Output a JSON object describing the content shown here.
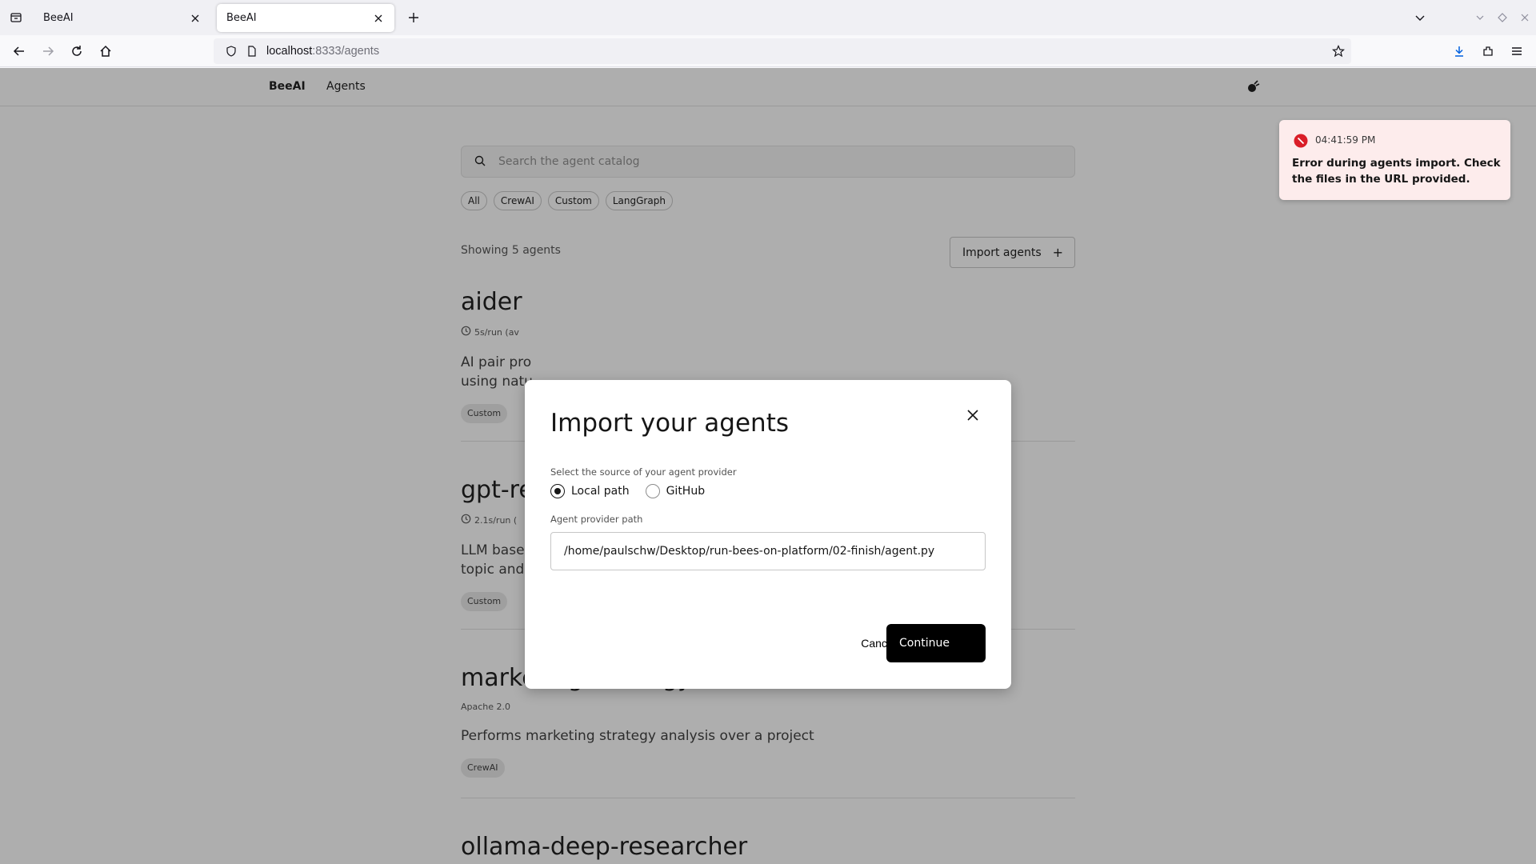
{
  "browser": {
    "tabs": [
      {
        "title": "BeeAI"
      },
      {
        "title": "BeeAI"
      }
    ],
    "url_host": "localhost",
    "url_path": ":8333/agents"
  },
  "app": {
    "brand": "BeeAI",
    "nav_agents": "Agents",
    "search_placeholder": "Search the agent catalog",
    "filters": [
      "All",
      "CrewAI",
      "Custom",
      "LangGraph"
    ],
    "showing": "Showing 5 agents",
    "import_button": "Import agents",
    "agents": [
      {
        "name": "aider",
        "meta": "5s/run (av",
        "desc_line1": "AI pair pro",
        "desc_line2": "using natu",
        "tag": "Custom"
      },
      {
        "name": "gpt-re",
        "meta": "2.1s/run (",
        "desc_line1": "LLM based",
        "desc_line2": "topic and",
        "tag": "Custom"
      },
      {
        "name": "marketing-strategy",
        "meta": "Apache 2.0",
        "desc_line1": "Performs marketing strategy analysis over a project",
        "desc_line2": "",
        "tag": "CrewAI"
      },
      {
        "name": "ollama-deep-researcher"
      }
    ]
  },
  "toast": {
    "time": "04:41:59 PM",
    "message": "Error during agents import. Check the files in the URL provided."
  },
  "modal": {
    "title": "Import your agents",
    "source_label": "Select the source of your agent provider",
    "options": [
      "Local path",
      "GitHub"
    ],
    "selected": "Local path",
    "path_label": "Agent provider path",
    "path_value": "/home/paulschw/Desktop/run-bees-on-platform/02-finish/agent.py",
    "cancel": "Cancel",
    "continue": "Continue"
  },
  "colors": {
    "error": "#da1e28",
    "accent_download": "#0060df",
    "primary_button": "#000000"
  }
}
